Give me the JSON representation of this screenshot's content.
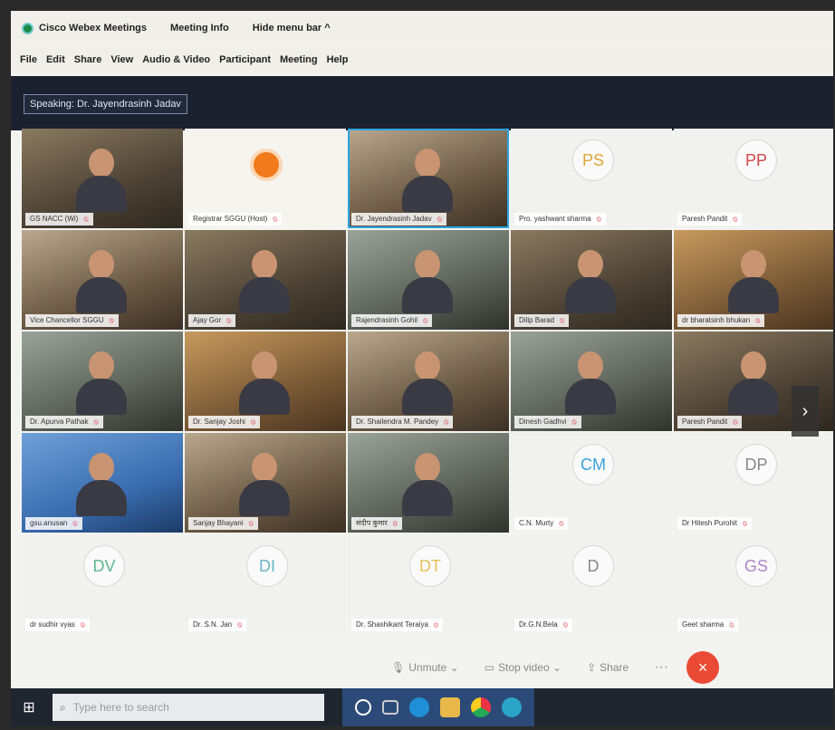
{
  "titlebar": {
    "app_title": "Cisco Webex Meetings",
    "meeting_info": "Meeting Info",
    "hide_menu": "Hide menu bar ^"
  },
  "menu": [
    "File",
    "Edit",
    "Share",
    "View",
    "Audio & Video",
    "Participant",
    "Meeting",
    "Help"
  ],
  "speaking": "Speaking: Dr. Jayendrasinh Jadav",
  "tiles": [
    {
      "name": "GS NACC (Wi)",
      "kind": "video",
      "style": "v1"
    },
    {
      "name": "Registrar SGGU (Host)",
      "kind": "logo",
      "style": "v1"
    },
    {
      "name": "Dr. Jayendrasinh Jadav",
      "kind": "video",
      "style": "v2",
      "active": true
    },
    {
      "name": "Pro. yashwant sharma",
      "kind": "avatar",
      "initials": "PS",
      "color": "#e0a43a"
    },
    {
      "name": "Paresh Pandit",
      "kind": "avatar",
      "initials": "PP",
      "color": "#d04848"
    },
    {
      "name": "Vice Chancellor SGGU",
      "kind": "video",
      "style": "v2"
    },
    {
      "name": "Ajay Gor",
      "kind": "video",
      "style": "v1"
    },
    {
      "name": "Rajendrasinh Gohil",
      "kind": "video",
      "style": "v3"
    },
    {
      "name": "Dilip Barad",
      "kind": "video",
      "style": "v1"
    },
    {
      "name": "dr bharatsinh bhukan",
      "kind": "video",
      "style": "v4"
    },
    {
      "name": "Dr. Apurva Pathak",
      "kind": "video",
      "style": "v3"
    },
    {
      "name": "Dr. Sanjay Joshi",
      "kind": "video",
      "style": "v4"
    },
    {
      "name": "Dr. Shailendra M. Pandey",
      "kind": "video",
      "style": "v2"
    },
    {
      "name": "Dinesh Gadhvi",
      "kind": "video",
      "style": "v3"
    },
    {
      "name": "Paresh Pandit",
      "kind": "video",
      "style": "v1"
    },
    {
      "name": "gsu.anusan",
      "kind": "video",
      "style": "v5"
    },
    {
      "name": "Sanjay Bhayani",
      "kind": "video",
      "style": "v2"
    },
    {
      "name": "संदीप कुमार",
      "kind": "video",
      "style": "v3"
    },
    {
      "name": "C.N. Murty",
      "kind": "avatar",
      "initials": "CM",
      "color": "#3aa2d8"
    },
    {
      "name": "Dr Hitesh Purohit",
      "kind": "avatar",
      "initials": "DP",
      "color": "#888888"
    },
    {
      "name": "dr sudhir vyas",
      "kind": "avatar",
      "initials": "DV",
      "color": "#5fb98e"
    },
    {
      "name": "Dr. S.N. Jan",
      "kind": "avatar",
      "initials": "DI",
      "color": "#6bb5c8"
    },
    {
      "name": "Dr. Shashikant Teraiya",
      "kind": "avatar",
      "initials": "DT",
      "color": "#e7c05a"
    },
    {
      "name": "Dr.G.N.Bela",
      "kind": "avatar",
      "initials": "D",
      "color": "#888888"
    },
    {
      "name": "Geet sharma",
      "kind": "avatar",
      "initials": "GS",
      "color": "#b084c8"
    }
  ],
  "controls": {
    "unmute": "Unmute",
    "stop_video": "Stop video",
    "share": "Share",
    "more": "···",
    "end": "×"
  },
  "taskbar": {
    "search_placeholder": "Type here to search"
  },
  "colors": {
    "accent_active": "#2aa5e0",
    "end_call": "#ea4a34"
  }
}
